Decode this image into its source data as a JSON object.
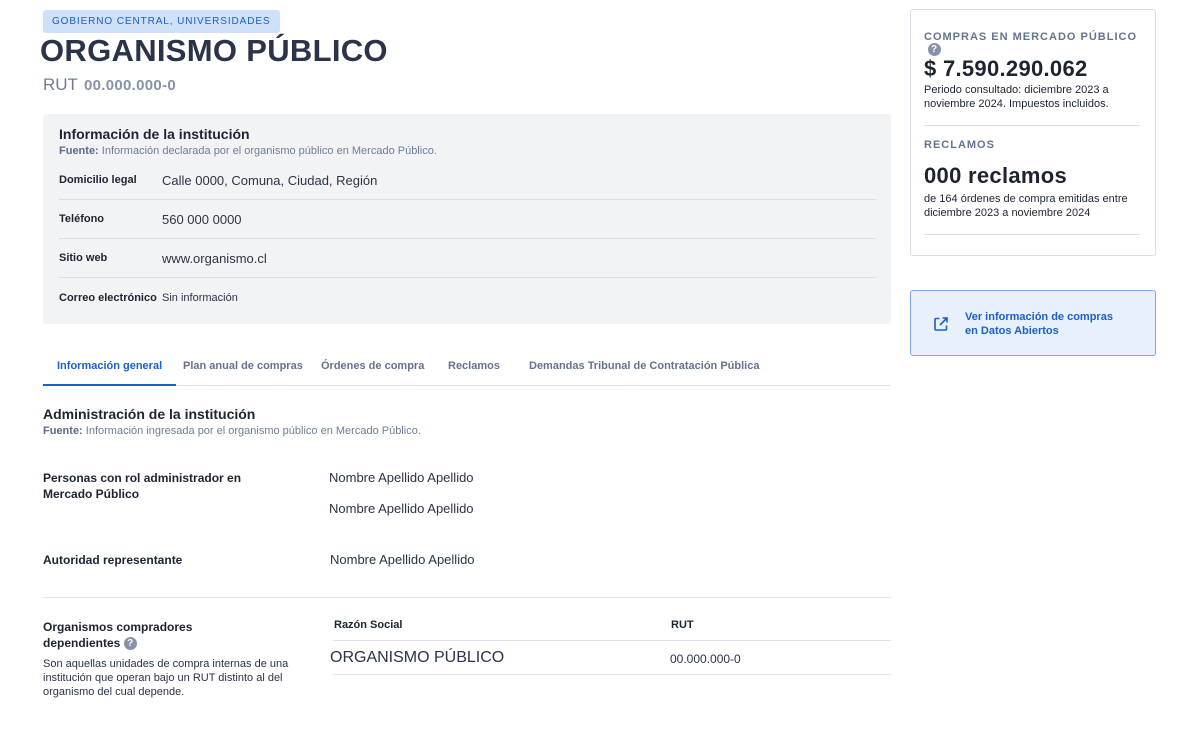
{
  "header": {
    "badge": "GOBIERNO CENTRAL, UNIVERSIDADES",
    "title": "ORGANISMO PÚBLICO",
    "rut_label": "RUT",
    "rut_value": "00.000.000-0"
  },
  "institution_info": {
    "title": "Información de la institución",
    "source_label": "Fuente:",
    "source_text": "Información declarada por el organismo público en Mercado Público.",
    "rows": [
      {
        "label": "Domicilio legal",
        "value": "Calle 0000, Comuna, Ciudad, Región"
      },
      {
        "label": "Teléfono",
        "value": "560 000 0000"
      },
      {
        "label": "Sitio web",
        "value": "www.organismo.cl"
      },
      {
        "label": "Correo electrónico",
        "value": "Sin información"
      }
    ]
  },
  "tabs": [
    {
      "label": "Información general",
      "active": true
    },
    {
      "label": "Plan anual de compras",
      "active": false
    },
    {
      "label": "Órdenes de compra",
      "active": false
    },
    {
      "label": "Reclamos",
      "active": false
    },
    {
      "label": "Demandas Tribunal de Contratación Pública",
      "active": false
    }
  ],
  "administration": {
    "title": "Administración de la institución",
    "source_label": "Fuente:",
    "source_text": "Información ingresada por el organismo público en Mercado Público.",
    "admins_label": "Personas con rol administrador en Mercado Público",
    "admins": [
      "Nombre Apellido Apellido",
      "Nombre Apellido Apellido"
    ],
    "authority_label": "Autoridad representante",
    "authority": "Nombre Apellido Apellido",
    "dependents_label": "Organismos compradores dependientes",
    "dependents_description": "Son aquellas unidades de compra internas de una institución que operan bajo un RUT distinto al del organismo del cual depende.",
    "table": {
      "headers": [
        "Razón Social",
        "RUT"
      ],
      "rows": [
        [
          "ORGANISMO PÚBLICO",
          "00.000.000-0"
        ]
      ]
    }
  },
  "summary": {
    "purchases_label": "COMPRAS EN MERCADO PÚBLICO",
    "purchases_amount": "$ 7.590.290.062",
    "purchases_desc": "Periodo consultado: diciembre 2023 a noviembre 2024. Impuestos incluidos.",
    "claims_label": "RECLAMOS",
    "claims_count": "000 reclamos",
    "claims_desc": "de 164 órdenes de compra emitidas entre diciembre 2023 a noviembre 2024"
  },
  "open_data_link": {
    "label": "Ver información de compras en Datos Abiertos",
    "icon": "external-link-icon"
  },
  "icons": {
    "help": "?"
  },
  "colors": {
    "accent": "#1b5fc9",
    "badge_bg": "#cfe0f9",
    "link_card_bg": "#e8f0fc"
  }
}
